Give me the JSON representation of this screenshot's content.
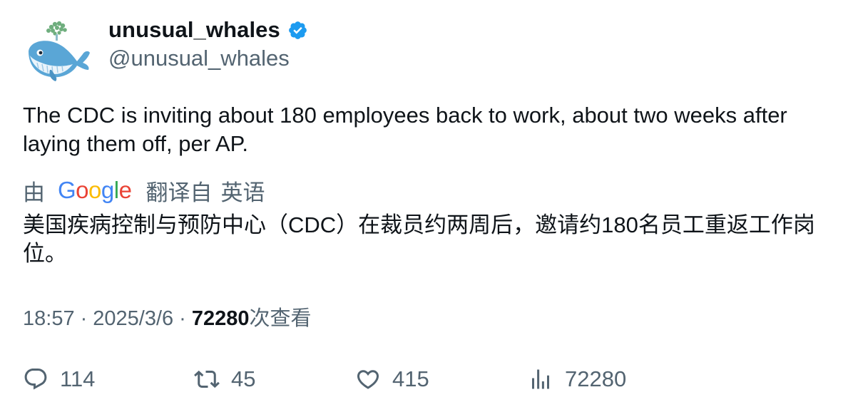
{
  "user": {
    "display_name": "unusual_whales",
    "handle": "@unusual_whales",
    "verified_icon": "verified-badge-icon",
    "avatar_icon": "whale-avatar"
  },
  "tweet": {
    "text": "The CDC is inviting about 180 employees back to work, about two weeks after laying them off, per AP.",
    "translation": {
      "by_label": "由",
      "provider": "Google",
      "from_label": "翻译自",
      "language": "英语",
      "text": "美国疾病控制与预防中心（CDC）在裁员约两周后，邀请约180名员工重返工作岗位。"
    },
    "meta": {
      "time": "18:57",
      "separator": "·",
      "date": "2025/3/6",
      "views_count": "72280",
      "views_label": "次查看"
    }
  },
  "actions": {
    "reply": {
      "icon": "reply-icon",
      "count": "114"
    },
    "retweet": {
      "icon": "retweet-icon",
      "count": "45"
    },
    "like": {
      "icon": "heart-icon",
      "count": "415"
    },
    "views": {
      "icon": "views-chart-icon",
      "count": "72280"
    }
  },
  "colors": {
    "text_primary": "#0f1419",
    "text_secondary": "#536471",
    "verified_blue": "#1d9bf0",
    "google_blue": "#4285f4",
    "google_red": "#ea4335",
    "google_yellow": "#fbbc05",
    "google_green": "#34a853"
  }
}
